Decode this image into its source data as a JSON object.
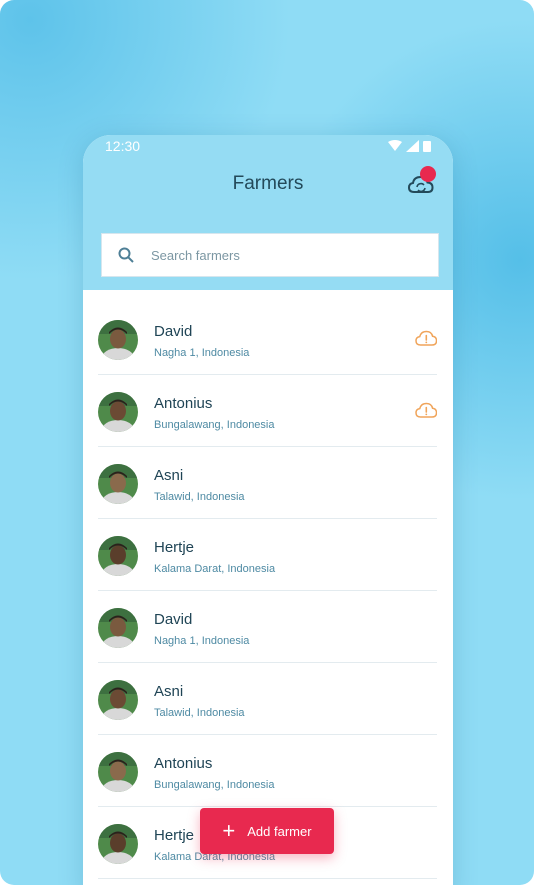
{
  "status_bar": {
    "time": "12:30"
  },
  "header": {
    "title": "Farmers",
    "sync_icon": "cloud-sync-icon"
  },
  "search": {
    "placeholder": "Search farmers",
    "value": ""
  },
  "farmers": [
    {
      "name": "David",
      "location": "Nagha 1, Indonesia",
      "warning": true
    },
    {
      "name": "Antonius",
      "location": "Bungalawang, Indonesia",
      "warning": true
    },
    {
      "name": "Asni",
      "location": "Talawid, Indonesia",
      "warning": false
    },
    {
      "name": "Hertje",
      "location": "Kalama Darat, Indonesia",
      "warning": false
    },
    {
      "name": "David",
      "location": "Nagha 1, Indonesia",
      "warning": false
    },
    {
      "name": "Asni",
      "location": "Talawid, Indonesia",
      "warning": false
    },
    {
      "name": "Antonius",
      "location": "Bungalawang, Indonesia",
      "warning": false
    },
    {
      "name": "Hertje",
      "location": "Kalama Darat, Indonesia",
      "warning": false
    }
  ],
  "fab": {
    "label": "Add farmer"
  },
  "colors": {
    "accent": "#e8294f",
    "header_bg": "#95dcf3",
    "warning": "#f0a45a",
    "text_primary": "#1f4455",
    "text_secondary": "#4e8aa3"
  }
}
